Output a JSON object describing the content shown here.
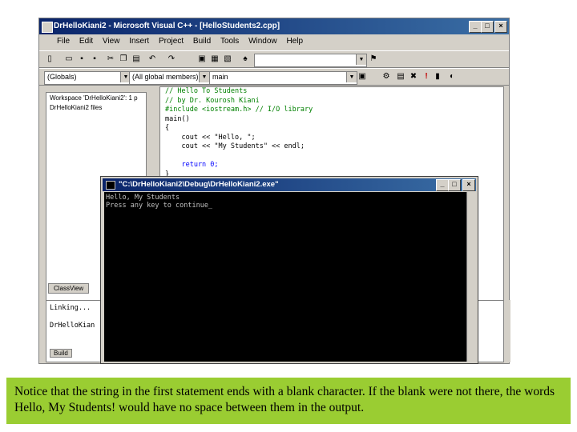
{
  "ide": {
    "title": "DrHelloKiani2 - Microsoft Visual C++ - [HelloStudents2.cpp]",
    "menu": [
      "File",
      "Edit",
      "View",
      "Insert",
      "Project",
      "Build",
      "Tools",
      "Window",
      "Help"
    ],
    "scope_combo": "(Globals)",
    "members_combo": "(All global members)",
    "function_combo": "main",
    "workspace_items": [
      "Workspace 'DrHelloKiani2': 1 p",
      "DrHelloKiani2 files"
    ],
    "workspace_tab": "ClassView",
    "code_lines": [
      "// Hello To Students",
      "// by Dr. Kourosh Kiani",
      "#include <iostream.h> // I/O library",
      "main()",
      "{",
      "    cout << \"Hello, \";",
      "    cout << \"My Students\" << endl;",
      "",
      "    return 0;",
      "}"
    ],
    "output_lines": [
      "Linking...",
      "",
      "DrHelloKian"
    ],
    "output_tab": "Build"
  },
  "console": {
    "title": "\"C:\\DrHelloKiani2\\Debug\\DrHelloKiani2.exe\"",
    "line1": "Hello, My Students",
    "line2": "Press any key to continue_"
  },
  "caption": "Notice that the string in the first statement ends with a blank character. If the blank were not there, the words Hello, My Students! would have no space between them in the output."
}
